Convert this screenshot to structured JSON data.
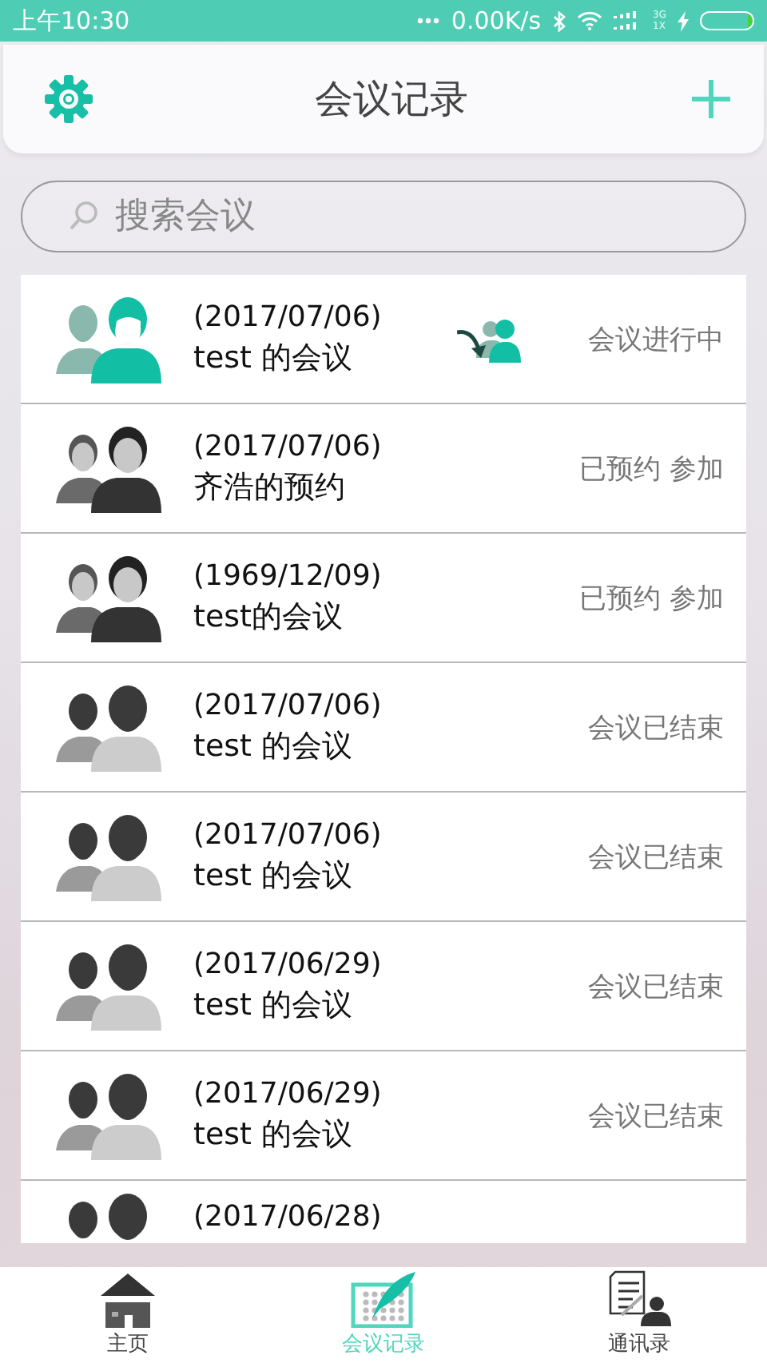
{
  "status_bar": {
    "time": "上午10:30",
    "speed": "0.00K/s",
    "network_top": "3G",
    "network_bottom": "1X"
  },
  "header": {
    "title": "会议记录"
  },
  "search": {
    "placeholder": "搜索会议"
  },
  "meetings": [
    {
      "kind": "ongoing",
      "date": "(2017/07/06)",
      "title": "test 的会议",
      "status": "会议进行中"
    },
    {
      "kind": "booked",
      "date": "(2017/07/06)",
      "title": "齐浩的预约",
      "status": "已预约 参加"
    },
    {
      "kind": "booked",
      "date": "(1969/12/09)",
      "title": "test的会议",
      "status": "已预约 参加"
    },
    {
      "kind": "ended",
      "date": "(2017/07/06)",
      "title": "test 的会议",
      "status": "会议已结束"
    },
    {
      "kind": "ended",
      "date": "(2017/07/06)",
      "title": "test 的会议",
      "status": "会议已结束"
    },
    {
      "kind": "ended",
      "date": "(2017/06/29)",
      "title": "test 的会议",
      "status": "会议已结束"
    },
    {
      "kind": "ended",
      "date": "(2017/06/29)",
      "title": "test 的会议",
      "status": "会议已结束"
    },
    {
      "kind": "ended",
      "date": "(2017/06/28)"
    }
  ],
  "nav": [
    {
      "kind": "home",
      "label": "主页",
      "selected": false
    },
    {
      "kind": "meetings",
      "label": "会议记录",
      "selected": true
    },
    {
      "kind": "contacts",
      "label": "通讯录",
      "selected": false
    }
  ]
}
